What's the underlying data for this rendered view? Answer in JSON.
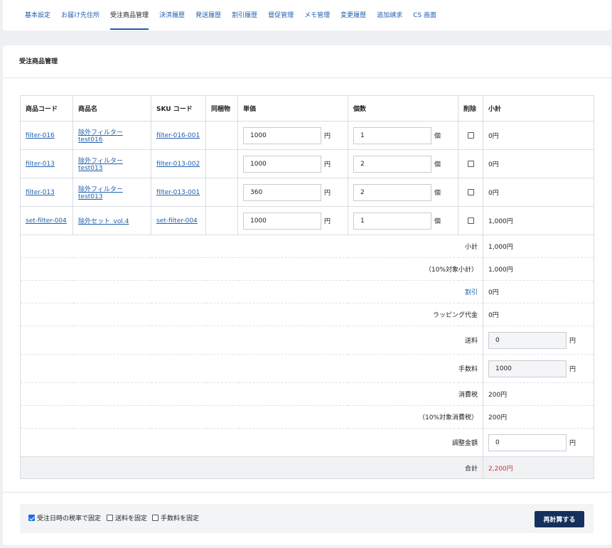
{
  "tabs": [
    {
      "label": "基本設定"
    },
    {
      "label": "お届け先住所"
    },
    {
      "label": "受注商品管理"
    },
    {
      "label": "決済履歴"
    },
    {
      "label": "発送履歴"
    },
    {
      "label": "割引履歴"
    },
    {
      "label": "督促管理"
    },
    {
      "label": "メモ管理"
    },
    {
      "label": "変更履歴"
    },
    {
      "label": "追加請求"
    },
    {
      "label": "CS 画面"
    }
  ],
  "active_tab": "受注商品管理",
  "section_title": "受注商品管理",
  "table": {
    "headers": [
      "商品コード",
      "商品名",
      "SKU コード",
      "同梱物",
      "単価",
      "個数",
      "削除",
      "小計"
    ],
    "rows": [
      {
        "code": "filter-016",
        "name": "除外フィルターtest016",
        "sku": "filter-016-001",
        "bundle": "",
        "price": "1000",
        "price_unit": "円",
        "qty": "1",
        "qty_unit": "個",
        "subtotal": "0円"
      },
      {
        "code": "filter-013",
        "name": "除外フィルターtest013",
        "sku": "filter-013-002",
        "bundle": "",
        "price": "1000",
        "price_unit": "円",
        "qty": "2",
        "qty_unit": "個",
        "subtotal": "0円"
      },
      {
        "code": "filter-013",
        "name": "除外フィルターtest013",
        "sku": "filter-013-001",
        "bundle": "",
        "price": "360",
        "price_unit": "円",
        "qty": "2",
        "qty_unit": "個",
        "subtotal": "0円"
      },
      {
        "code": "set-filter-004",
        "name": "除外セット_vol.4",
        "sku": "set-filter-004",
        "bundle": "",
        "price": "1000",
        "price_unit": "円",
        "qty": "1",
        "qty_unit": "個",
        "subtotal": "1,000円"
      }
    ]
  },
  "summary": {
    "subtotal": {
      "label": "小計",
      "value": "1,000円"
    },
    "subtotal_10": {
      "label": "（10%対象小計）",
      "value": "1,000円"
    },
    "discount": {
      "label": "割引",
      "value": "0円"
    },
    "wrapping": {
      "label": "ラッピング代金",
      "value": "0円"
    },
    "shipping": {
      "label": "送料",
      "value": "0",
      "unit": "円"
    },
    "fee": {
      "label": "手数料",
      "value": "1000",
      "unit": "円"
    },
    "tax": {
      "label": "消費税",
      "value": "200円"
    },
    "tax_10": {
      "label": "（10%対象消費税）",
      "value": "200円"
    },
    "adjust": {
      "label": "調整金額",
      "value": "0",
      "unit": "円"
    },
    "total": {
      "label": "合計",
      "value": "2,200円"
    }
  },
  "options": {
    "fix_tax": {
      "label": "受注日時の税率で固定",
      "checked": true
    },
    "fix_shipping": {
      "label": "送料を固定",
      "checked": false
    },
    "fix_fee": {
      "label": "手数料を固定",
      "checked": false
    }
  },
  "recalc_button": "再計算する",
  "colors": {
    "accent": "#1f5fae",
    "button": "#15305c",
    "total_red": "#c8343c"
  }
}
